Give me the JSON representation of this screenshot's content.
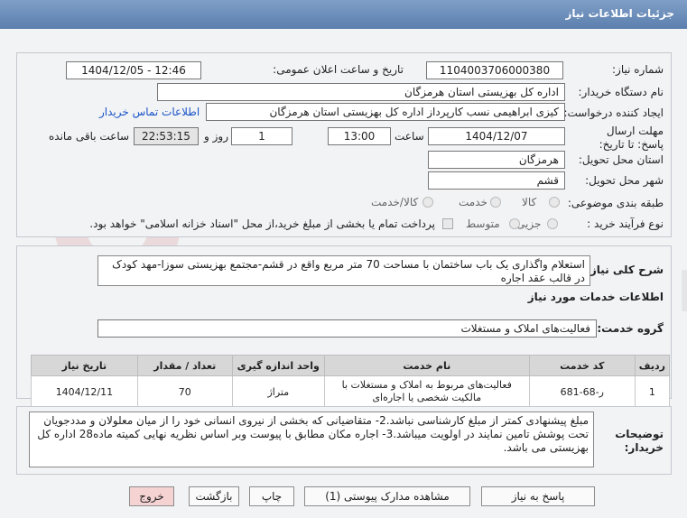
{
  "window_title": "جزئیات اطلاعات نیاز",
  "fields": {
    "need_number_label": "شماره نیاز:",
    "need_number": "1104003706000380",
    "announce_label": "تاریخ و ساعت اعلان عمومی:",
    "announce_value": "1404/12/05 - 12:46",
    "buyer_org_label": "نام دستگاه خریدار:",
    "buyer_org": "اداره کل بهزیستی استان هرمزگان",
    "creator_label": "ایجاد کننده درخواست:",
    "creator": "کیزی  ابراهیمی نسب کارپرداز اداره کل بهزیستی استان هرمزگان",
    "contact_link": "اطلاعات تماس خریدار",
    "deadline_label": "مهلت ارسال پاسخ: تا تاریخ:",
    "deadline_date": "1404/12/07",
    "time_label": "ساعت",
    "deadline_time": "13:00",
    "days_value": "1",
    "days_label": "روز و",
    "remaining_time": "22:53:15",
    "remaining_label": "ساعت باقی مانده",
    "province_label": "استان محل تحویل:",
    "province": "هرمزگان",
    "city_label": "شهر محل تحویل:",
    "city": "قشم",
    "category_label": "طبقه بندی موضوعی:",
    "category_options": [
      "کالا",
      "خدمت",
      "کالا/خدمت"
    ],
    "process_label": "نوع فرآیند خرید :",
    "process_options": [
      "جزیی",
      "متوسط"
    ],
    "payment_note": "پرداخت تمام یا بخشی از مبلغ خرید،از محل \"اسناد خزانه اسلامی\" خواهد بود."
  },
  "description": {
    "label": "شرح کلی نیاز:",
    "text": "استعلام واگذاری یک باب ساختمان با مساحت 70 متر مربع واقع در قشم-مجتمع بهزیستی سوزا-مهد کودک در قالب عقد اجاره"
  },
  "services": {
    "section_title": "اطلاعات خدمات مورد نیاز",
    "group_label": "گروه خدمت:",
    "group_value": "فعالیت‌های  املاک و مستغلات",
    "headers": [
      "ردیف",
      "کد خدمت",
      "نام خدمت",
      "واحد اندازه گیری",
      "تعداد / مقدار",
      "تاریخ نیاز"
    ],
    "rows": [
      [
        "1",
        "ر-68-681",
        "فعالیت‌های مربوط به املاک و مستغلات با مالکیت شخصی یا اجاره‌ای",
        "متراژ",
        "70",
        "1404/12/11"
      ]
    ]
  },
  "buyer_notes": {
    "label": "توضیحات خریدار:",
    "text": "مبلغ پیشنهادی کمتر از مبلغ کارشناسی نباشد.2- متقاضیانی که بخشی از نیروی انسانی خود را از میان معلولان و مددجویان تحت پوشش تامین نمایند در اولویت میباشد.3-  اجاره مکان  مطابق با پیوست وبر اساس نظریه نهایی کمیته ماده28 اداره کل بهزیستی می باشد."
  },
  "buttons": {
    "reply": "پاسخ به نیاز",
    "attachments": "مشاهده مدارک پیوستی (1)",
    "print": "چاپ",
    "back": "بازگشت",
    "exit": "خروج"
  },
  "colors": {
    "title_bar": "#6a8dbb",
    "link": "#1a55c8",
    "exit_button": "#f6d3d3"
  }
}
